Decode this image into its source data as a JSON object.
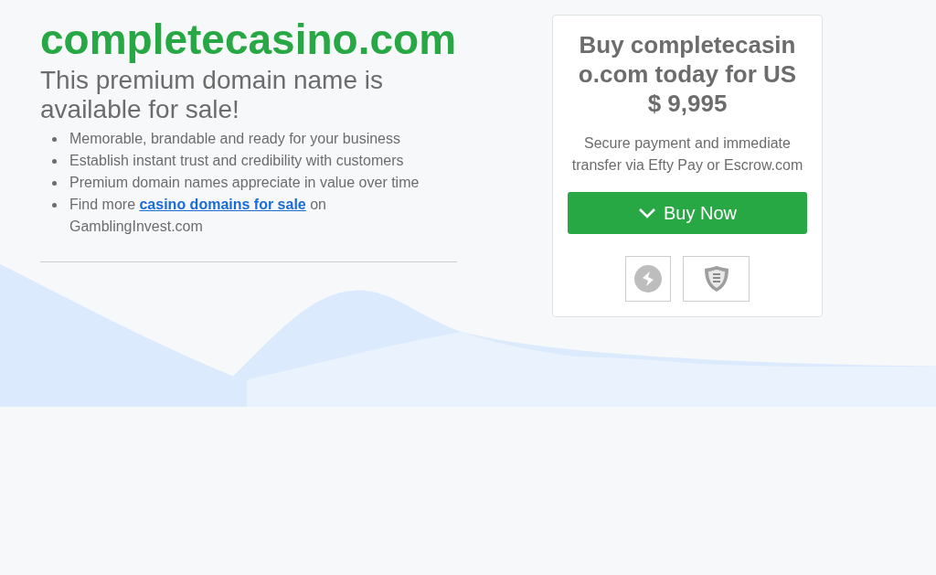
{
  "domain": "completecasino.com",
  "subtitle": "This premium domain name is available for sale!",
  "features": [
    {
      "kind": "text",
      "text": "Memorable, brandable and ready for your business"
    },
    {
      "kind": "text",
      "text": "Establish instant trust and credibility with customers"
    },
    {
      "kind": "text",
      "text": "Premium domain names appreciate in value over time"
    },
    {
      "kind": "link",
      "before": "Find more ",
      "link": "casino domains for sale",
      "after": " on GamblingInvest.com"
    }
  ],
  "card": {
    "title": "Buy completecasino.com today for US$ 9,995",
    "note": "Secure payment and immediate transfer via Efty Pay or Escrow.com",
    "button": "Buy Now"
  }
}
